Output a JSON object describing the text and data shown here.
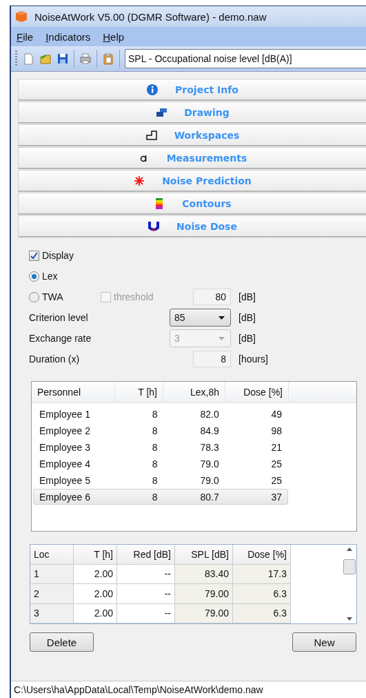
{
  "window": {
    "title": "NoiseAtWork V5.00 (DGMR Software) - demo.naw"
  },
  "menu": [
    "File",
    "Indicators",
    "Help"
  ],
  "toolbar": {
    "indicator": "SPL - Occupational noise level [dB(A)]"
  },
  "panels": [
    {
      "label": "Project Info"
    },
    {
      "label": "Drawing"
    },
    {
      "label": "Workspaces"
    },
    {
      "label": "Measurements"
    },
    {
      "label": "Noise Prediction"
    },
    {
      "label": "Contours"
    },
    {
      "label": "Noise Dose"
    }
  ],
  "form": {
    "display": {
      "label": "Display",
      "checked": true
    },
    "radios": [
      {
        "label": "Lex",
        "selected": true
      },
      {
        "label": "TWA",
        "selected": false
      }
    ],
    "threshold": {
      "label": "threshold",
      "checked": false,
      "disabled": true,
      "value": "80",
      "unit": "[dB]"
    },
    "criterion": {
      "label": "Criterion level",
      "value": "85",
      "disabled": false,
      "unit": "[dB]"
    },
    "exchange": {
      "label": "Exchange rate",
      "value": "3",
      "disabled": true,
      "unit": "[dB]"
    },
    "duration": {
      "label": "Duration (x)",
      "value": "8",
      "unit": "[hours]"
    }
  },
  "personnel": {
    "columns": [
      "Personnel",
      "T [h]",
      "Lex,8h",
      "Dose [%]"
    ],
    "rows": [
      {
        "cells": [
          "Employee 1",
          "8",
          "82.0",
          "49"
        ],
        "selected": false
      },
      {
        "cells": [
          "Employee 2",
          "8",
          "84.9",
          "98"
        ],
        "selected": false
      },
      {
        "cells": [
          "Employee 3",
          "8",
          "78.3",
          "21"
        ],
        "selected": false
      },
      {
        "cells": [
          "Employee 4",
          "8",
          "79.0",
          "25"
        ],
        "selected": false
      },
      {
        "cells": [
          "Employee 5",
          "8",
          "79.0",
          "25"
        ],
        "selected": false
      },
      {
        "cells": [
          "Employee 6",
          "8",
          "80.7",
          "37"
        ],
        "selected": true
      }
    ]
  },
  "locations": {
    "columns": [
      "Loc",
      "T [h]",
      "Red [dB]",
      "SPL [dB]",
      "Dose [%]"
    ],
    "rows": [
      [
        "1",
        "2.00",
        "--",
        "83.40",
        "17.3"
      ],
      [
        "2",
        "2.00",
        "--",
        "79.00",
        "6.3"
      ],
      [
        "3",
        "2.00",
        "--",
        "79.00",
        "6.3"
      ]
    ]
  },
  "buttons": [
    "Delete",
    "New"
  ],
  "status_bar": "C:\\Users\\ha\\AppData\\Local\\Temp\\NoiseAtWork\\demo.naw"
}
